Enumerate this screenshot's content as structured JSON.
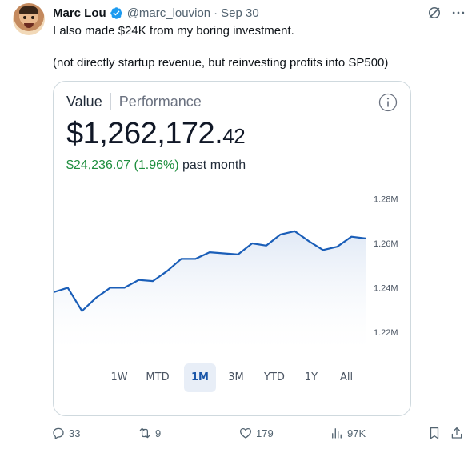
{
  "tweet": {
    "author_name": "Marc Lou",
    "handle": "@marc_louvion",
    "separator": "·",
    "date": "Sep 30",
    "text_line1": "I also made $24K from my boring investment.",
    "text_line2": "(not directly startup revenue, but reinvesting profits into SP500)"
  },
  "card": {
    "tab_active": "Value",
    "tab_inactive": "Performance",
    "value_main": "$1,262,172.",
    "value_cents": "42",
    "change_amount": "$24,236.07 (1.96%)",
    "change_period": "past month",
    "colors": {
      "line": "#1a5eb8",
      "fill_top": "#dfe8f5",
      "gain": "#1e8e3e",
      "active_range_bg": "#e8eef7"
    },
    "ranges": [
      "1W",
      "MTD",
      "1M",
      "3M",
      "YTD",
      "1Y",
      "All"
    ],
    "active_range": "1M"
  },
  "chart_data": {
    "type": "area",
    "y_tick_labels": [
      "1.28M",
      "1.26M",
      "1.24M",
      "1.22M"
    ],
    "y_ticks": [
      1280000,
      1260000,
      1240000,
      1220000
    ],
    "ylim": [
      1212000,
      1286000
    ],
    "values": [
      1238000,
      1240000,
      1229500,
      1235500,
      1240000,
      1240000,
      1243500,
      1243000,
      1247500,
      1253000,
      1253000,
      1256000,
      1255500,
      1255000,
      1260000,
      1259000,
      1264000,
      1265500,
      1261000,
      1257000,
      1258500,
      1263000,
      1262200
    ],
    "grid": false,
    "legend": "none"
  },
  "actions": {
    "replies": "33",
    "reposts": "9",
    "likes": "179",
    "views": "97K"
  }
}
